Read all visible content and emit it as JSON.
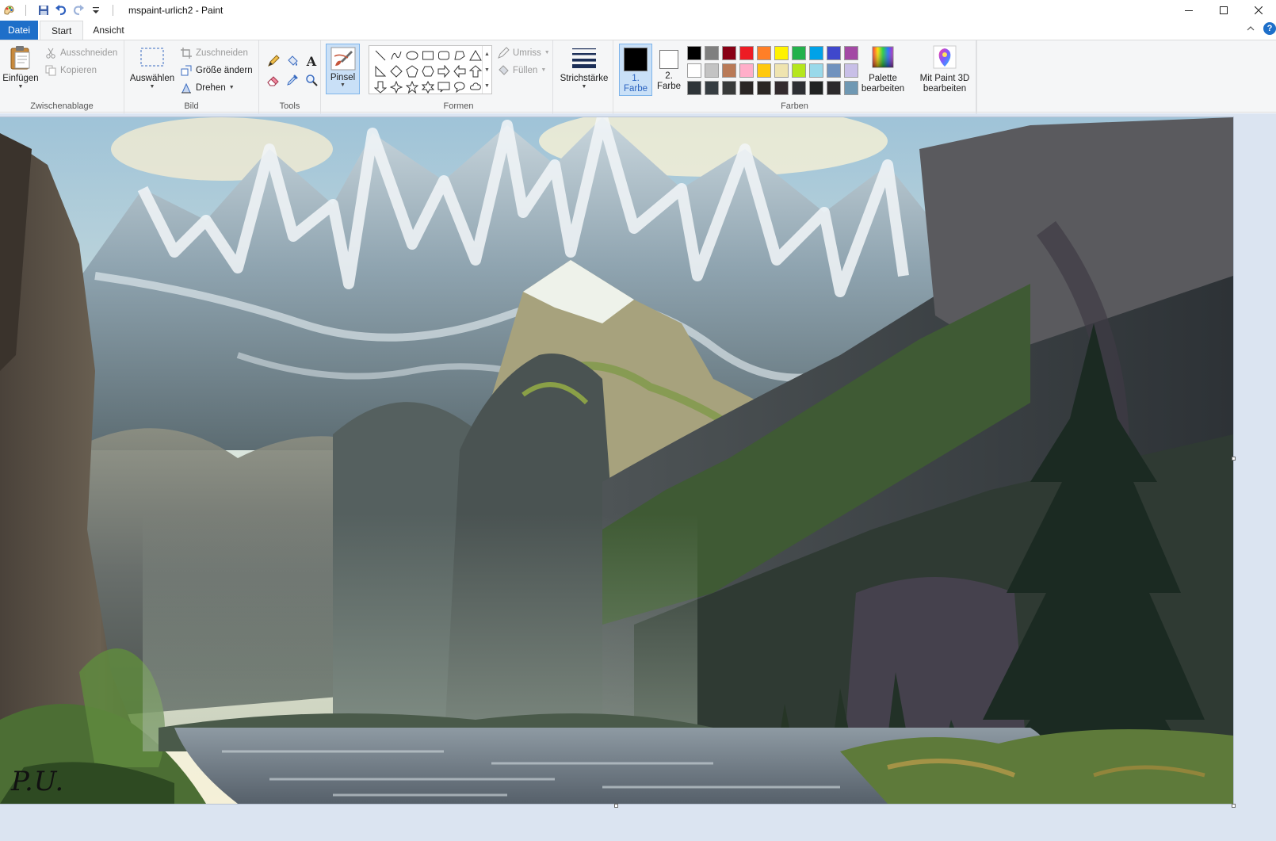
{
  "window": {
    "title": "mspaint-urlich2 - Paint",
    "icons": [
      "paint-app-icon",
      "save-icon",
      "undo-icon",
      "redo-icon",
      "customize-qat-icon"
    ]
  },
  "tabs": [
    {
      "label": "Datei"
    },
    {
      "label": "Start"
    },
    {
      "label": "Ansicht"
    }
  ],
  "help_label": "?",
  "ribbon": {
    "clipboard": {
      "label": "Zwischenablage",
      "paste": "Einfügen",
      "cut": "Ausschneiden",
      "copy": "Kopieren"
    },
    "image": {
      "label": "Bild",
      "select": "Auswählen",
      "crop": "Zuschneiden",
      "resize": "Größe ändern",
      "rotate": "Drehen"
    },
    "tools": {
      "label": "Tools",
      "brush": "Pinsel"
    },
    "shapes": {
      "label": "Formen",
      "outline": "Umriss",
      "fill": "Füllen"
    },
    "stroke": {
      "label": "Strichstärke"
    },
    "colors": {
      "label": "Farben",
      "color1_line1": "1.",
      "color1_line2": "Farbe",
      "color2_line1": "2.",
      "color2_line2": "Farbe",
      "color1_value": "#000000",
      "color2_value": "#ffffff",
      "edit_palette_line1": "Palette",
      "edit_palette_line2": "bearbeiten",
      "palette": [
        "#000000",
        "#7f7f7f",
        "#880015",
        "#ed1c24",
        "#ff7f27",
        "#fff200",
        "#22b14c",
        "#00a2e8",
        "#3f48cc",
        "#a349a4",
        "#ffffff",
        "#c3c3c3",
        "#b97a57",
        "#ffaec9",
        "#ffc90e",
        "#efe4b0",
        "#b5e61d",
        "#99d9ea",
        "#7092be",
        "#c8bfe7",
        "#2e3438",
        "#363d42",
        "#383a3a",
        "#2a2625",
        "#2b2724",
        "#332b2e",
        "#2d2f33",
        "#202222",
        "#2c2a2c",
        "#6f98b3"
      ]
    },
    "paint3d": {
      "line1": "Mit Paint 3D",
      "line2": "bearbeiten"
    }
  },
  "canvas": {
    "signature": "P.U."
  }
}
